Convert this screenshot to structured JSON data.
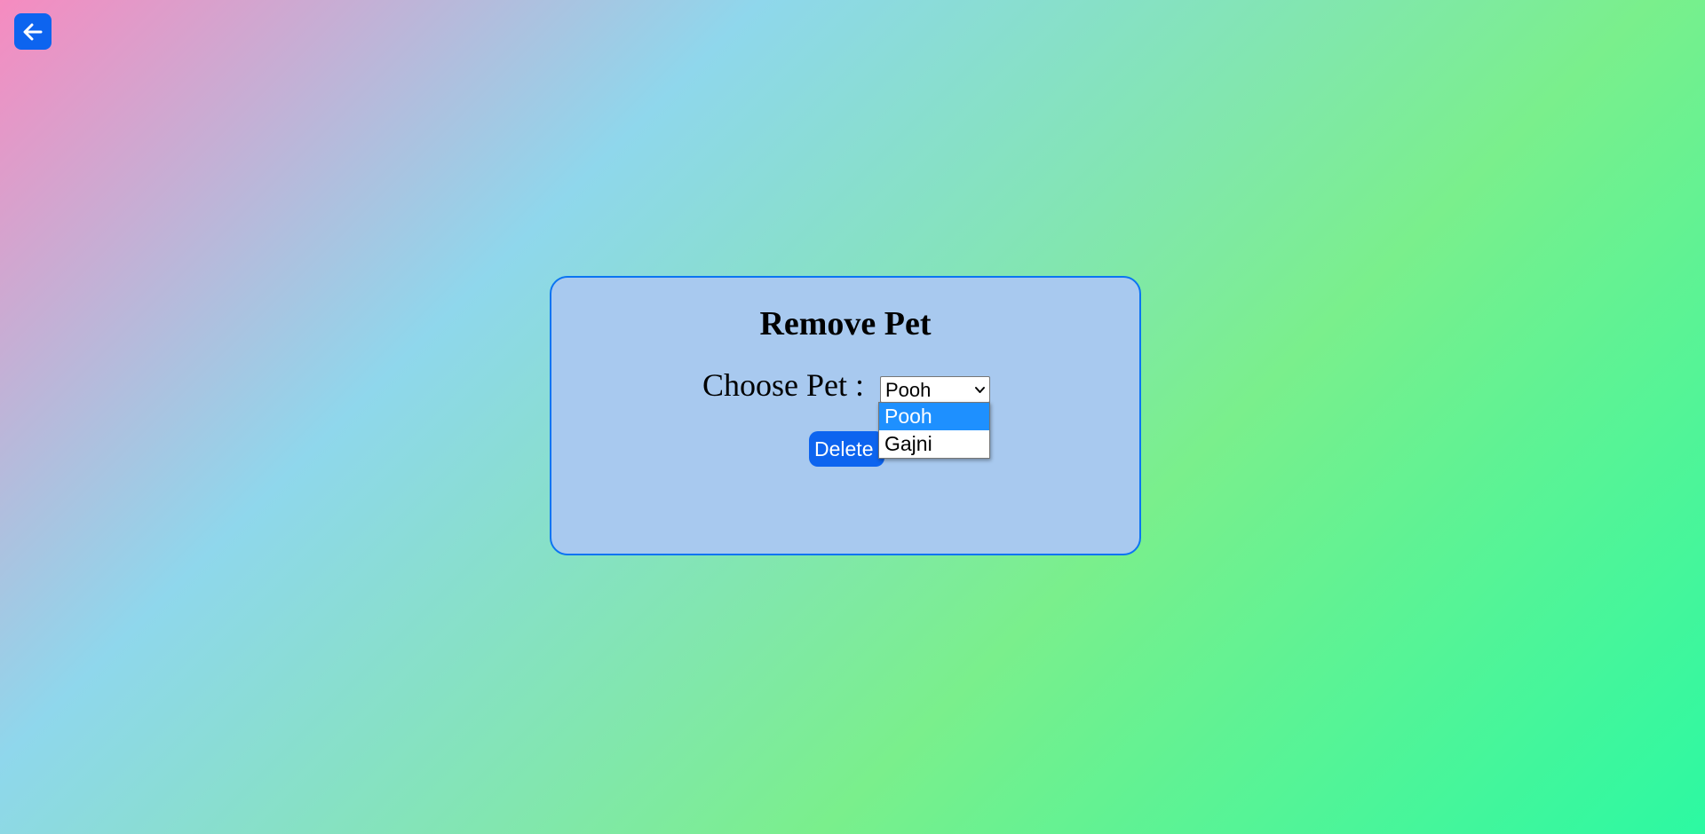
{
  "page": {
    "back_icon": "arrow-left-icon"
  },
  "colors": {
    "accent": "#0d64ef",
    "card_bg": "#a8c9ef",
    "card_border": "#0b74f2",
    "option_highlight": "#1e90ff"
  },
  "card": {
    "title": "Remove Pet",
    "choose_label": "Choose Pet :",
    "selected_pet": "Pooh",
    "delete_label": "Delete"
  },
  "dropdown": {
    "options": [
      {
        "label": "Pooh",
        "highlighted": true
      },
      {
        "label": "Gajni",
        "highlighted": false
      }
    ]
  }
}
